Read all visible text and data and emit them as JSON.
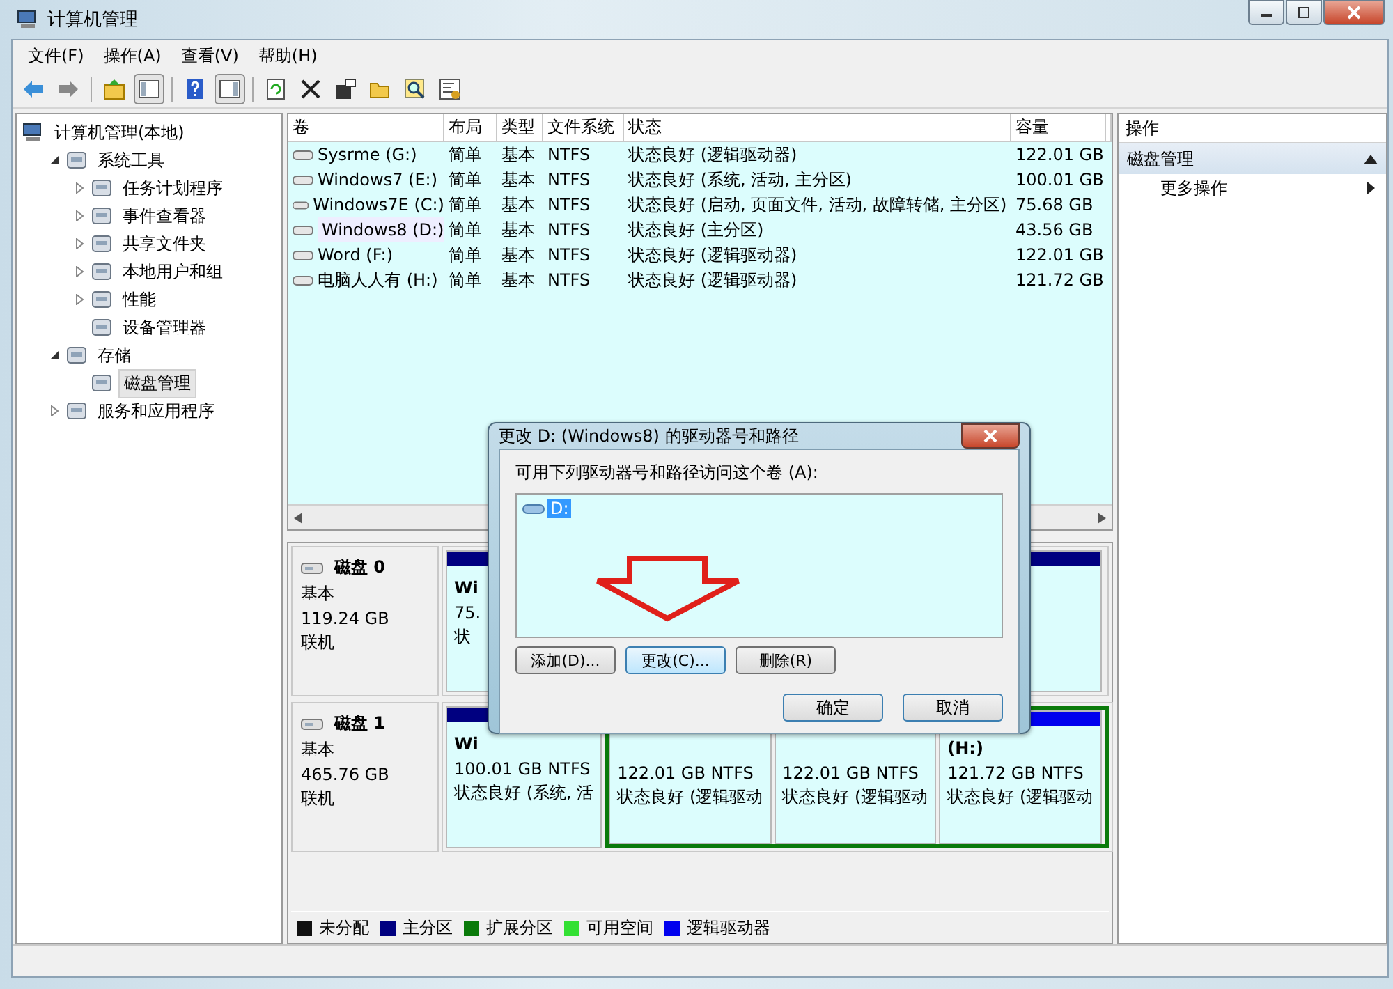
{
  "window": {
    "title": "计算机管理"
  },
  "menu": [
    "文件(F)",
    "操作(A)",
    "查看(V)",
    "帮助(H)"
  ],
  "tree": [
    {
      "label": "计算机管理(本地)",
      "selected": false,
      "children": [
        {
          "label": "系统工具",
          "selected": false,
          "expanded": true,
          "children": [
            {
              "label": "任务计划程序",
              "selected": false,
              "expanded": false
            },
            {
              "label": "事件查看器",
              "selected": false,
              "expanded": false
            },
            {
              "label": "共享文件夹",
              "selected": false,
              "expanded": false
            },
            {
              "label": "本地用户和组",
              "selected": false,
              "expanded": false
            },
            {
              "label": "性能",
              "selected": false,
              "expanded": false
            },
            {
              "label": "设备管理器",
              "selected": false
            }
          ]
        },
        {
          "label": "存储",
          "selected": false,
          "expanded": true,
          "children": [
            {
              "label": "磁盘管理",
              "selected": true
            }
          ]
        },
        {
          "label": "服务和应用程序",
          "selected": false,
          "expanded": false
        }
      ]
    }
  ],
  "table": {
    "columns": [
      "卷",
      "布局",
      "类型",
      "文件系统",
      "状态",
      "容量"
    ],
    "rows": [
      {
        "cells": [
          "Sysrme (G:)",
          "简单",
          "基本",
          "NTFS",
          "状态良好 (逻辑驱动器)",
          "122.01 GB"
        ],
        "selected": false
      },
      {
        "cells": [
          "Windows7 (E:)",
          "简单",
          "基本",
          "NTFS",
          "状态良好 (系统, 活动, 主分区)",
          "100.01 GB"
        ],
        "selected": false
      },
      {
        "cells": [
          "Windows7E (C:)",
          "简单",
          "基本",
          "NTFS",
          "状态良好 (启动, 页面文件, 活动, 故障转储, 主分区)",
          "75.68 GB"
        ],
        "selected": false
      },
      {
        "cells": [
          "Windows8 (D:)",
          "简单",
          "基本",
          "NTFS",
          "状态良好 (主分区)",
          "43.56 GB"
        ],
        "selected": true
      },
      {
        "cells": [
          "Word (F:)",
          "简单",
          "基本",
          "NTFS",
          "状态良好 (逻辑驱动器)",
          "122.01 GB"
        ],
        "selected": false
      },
      {
        "cells": [
          "电脑人人有 (H:)",
          "简单",
          "基本",
          "NTFS",
          "状态良好 (逻辑驱动器)",
          "121.72 GB"
        ],
        "selected": false
      }
    ]
  },
  "disks": [
    {
      "name": "磁盘 0",
      "type": "基本",
      "size": "119.24 GB",
      "status": "联机",
      "partitions": [
        {
          "kind": "primary",
          "name": "Wi",
          "size": "75.",
          "status": "状"
        }
      ]
    },
    {
      "name": "磁盘 1",
      "type": "基本",
      "size": "465.76 GB",
      "status": "联机",
      "partitions": [
        {
          "kind": "primary",
          "name": "Wi",
          "size": "100.01 GB NTFS",
          "status": "状态良好 (系统, 活"
        },
        {
          "kind": "extended",
          "children": [
            {
              "kind": "logical",
              "size": "122.01 GB NTFS",
              "status": "状态良好 (逻辑驱动"
            },
            {
              "kind": "logical",
              "size": "122.01 GB NTFS",
              "status": "状态良好 (逻辑驱动"
            },
            {
              "kind": "logical",
              "name": "(H:)",
              "size": "121.72 GB NTFS",
              "status": "状态良好 (逻辑驱动"
            }
          ]
        }
      ]
    }
  ],
  "legend": [
    {
      "label": "未分配",
      "color": "#111111"
    },
    {
      "label": "主分区",
      "color": "#000080"
    },
    {
      "label": "扩展分区",
      "color": "#0a7a0a"
    },
    {
      "label": "可用空间",
      "color": "#33e033"
    },
    {
      "label": "逻辑驱动器",
      "color": "#0000ee"
    }
  ],
  "actions": {
    "title": "操作",
    "section": {
      "label": "磁盘管理",
      "expanded": true
    },
    "items": [
      {
        "label": "更多操作"
      }
    ]
  },
  "dialog": {
    "title": "更改 D: (Windows8) 的驱动器号和路径",
    "prompt": "可用下列驱动器号和路径访问这个卷 (A):",
    "paths": [
      {
        "label": "D:",
        "selected": true
      }
    ],
    "path_buttons": [
      {
        "label": "添加(D)...",
        "focused": false
      },
      {
        "label": "更改(C)...",
        "focused": true
      },
      {
        "label": "删除(R)",
        "focused": false
      }
    ],
    "confirm_buttons": [
      "确定",
      "取消"
    ]
  }
}
